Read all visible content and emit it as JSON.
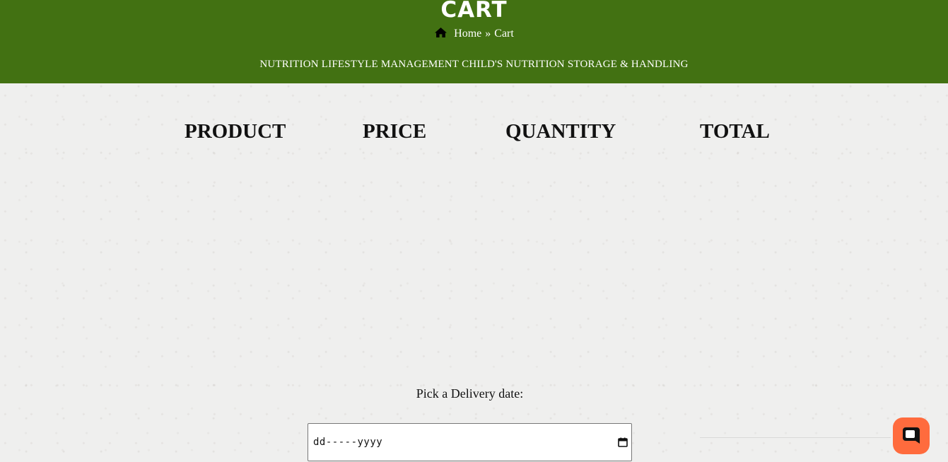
{
  "header": {
    "title": "CART",
    "breadcrumb": {
      "icon": "home-icon",
      "home": "Home",
      "separator": "»",
      "current": "Cart"
    },
    "nav": [
      {
        "label": "NUTRITION"
      },
      {
        "label": "LIFESTYLE MANAGEMENT"
      },
      {
        "label": "CHILD'S NUTRITION"
      },
      {
        "label": "STORAGE & HANDLING"
      }
    ],
    "background_color": "#427112"
  },
  "cart_table": {
    "columns": [
      "PRODUCT",
      "PRICE",
      "QUANTITY",
      "TOTAL"
    ],
    "rows": []
  },
  "delivery": {
    "label": "Pick a Delivery date:",
    "input_value": "dd-----yyyy",
    "icon": "calendar-icon"
  },
  "chat_widget": {
    "icon": "chat-icon",
    "color": "#ff6b3d"
  }
}
